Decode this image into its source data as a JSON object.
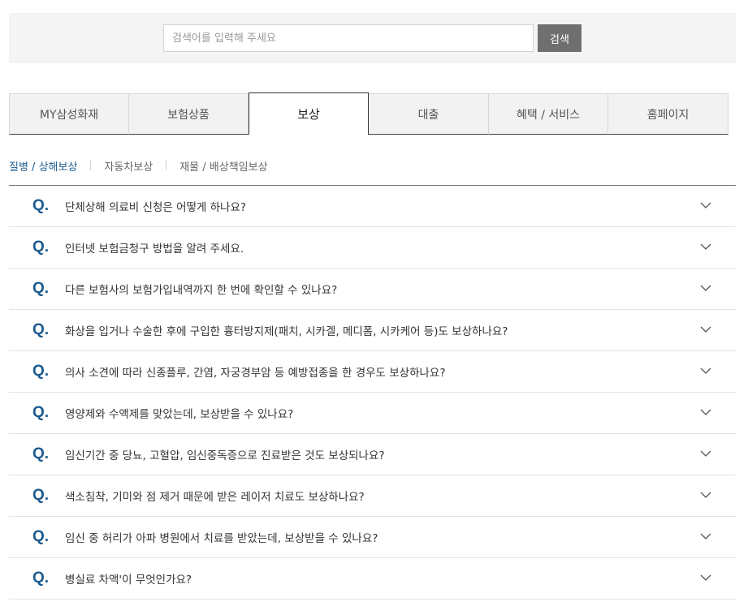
{
  "search": {
    "placeholder": "검색어를 입력해 주세요",
    "button_label": "검색"
  },
  "tabs": [
    {
      "label": "MY삼성화재",
      "active": false
    },
    {
      "label": "보험상품",
      "active": false
    },
    {
      "label": "보상",
      "active": true
    },
    {
      "label": "대출",
      "active": false
    },
    {
      "label": "혜택 / 서비스",
      "active": false
    },
    {
      "label": "홈페이지",
      "active": false
    }
  ],
  "subnav": [
    {
      "label": "질병 / 상해보상",
      "active": true
    },
    {
      "label": "자동차보상",
      "active": false
    },
    {
      "label": "재물 / 배상책임보상",
      "active": false
    }
  ],
  "faq": {
    "q_marker": "Q.",
    "items": [
      "단체상해 의료비 신청은 어떻게 하나요?",
      "인터넷 보험금청구 방법을 알려 주세요.",
      "다른 보험사의 보험가입내역까지 한 번에 확인할 수 있나요?",
      "화상을 입거나 수술한 후에 구입한 흉터방지제(패치, 시카겔, 메디폼, 시카케어 등)도 보상하나요?",
      "의사 소견에 따라 신종플루, 간염, 자궁경부암 등 예방접종을 한 경우도 보상하나요?",
      "영양제와 수액제를 맞았는데, 보상받을 수 있나요?",
      "임신기간 중 당뇨, 고혈압, 임신중독증으로 진료받은 것도 보상되나요?",
      "색소침착, 기미와 점 제거 때문에 받은 레이저 치료도 보상하나요?",
      "임신 중 허리가 아파 병원에서 치료를 받았는데, 보상받을 수 있나요?",
      "병실료 차액'이 무엇인가요?"
    ]
  },
  "colors": {
    "accent": "#1b5a8e",
    "search_button": "#6f6f6f",
    "tab_inactive_bg": "#f2f2f2"
  },
  "icons": {
    "faq_expand": "chevron-down-icon"
  }
}
